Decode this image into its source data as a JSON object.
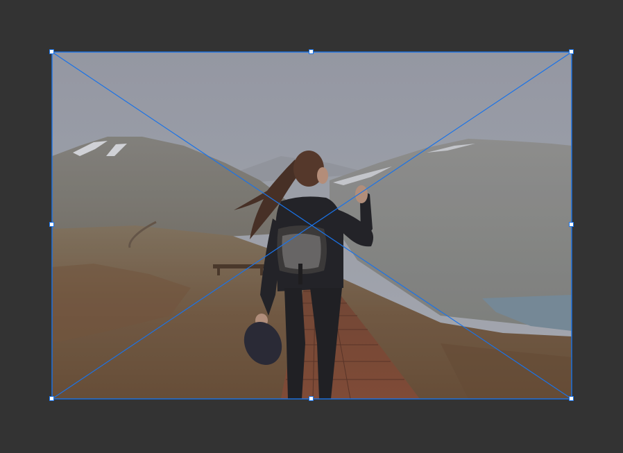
{
  "canvas": {
    "background_color": "#333333"
  },
  "selection": {
    "outline_color": "#1a73e8",
    "handle_fill": "#ffffff",
    "handles": [
      "top-left",
      "top-center",
      "top-right",
      "middle-left",
      "middle-right",
      "bottom-left",
      "bottom-center",
      "bottom-right"
    ]
  },
  "image": {
    "subject": "hiker-woman-on-boardwalk-mountains"
  }
}
